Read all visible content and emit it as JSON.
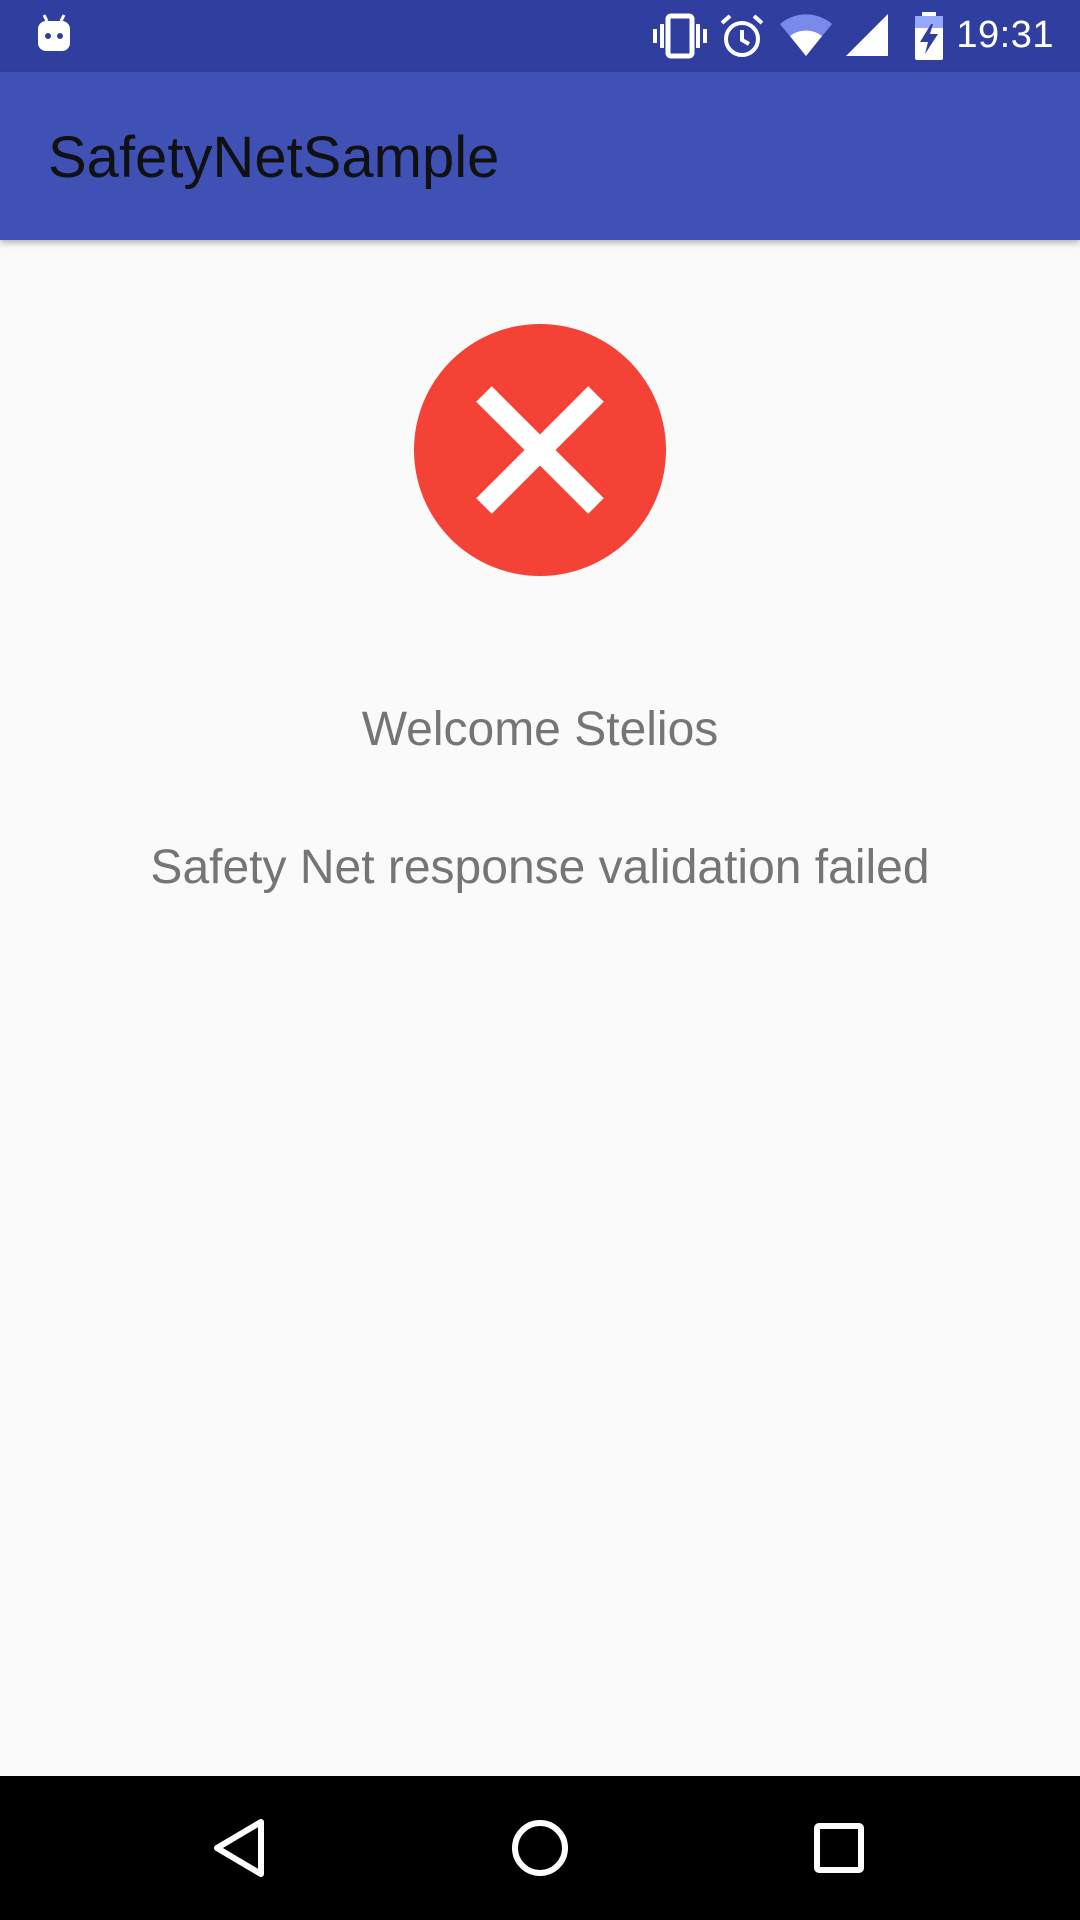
{
  "status_bar": {
    "time": "19:31",
    "notification_icon": "android-debug-icon",
    "icons": [
      "vibrate-icon",
      "alarm-icon",
      "wifi-icon",
      "cell-signal-icon",
      "battery-charging-icon"
    ]
  },
  "app_bar": {
    "title": "SafetyNetSample"
  },
  "main": {
    "status_icon": "error-cross-icon",
    "welcome_text": "Welcome Stelios",
    "result_text": "Safety Net response validation failed"
  },
  "nav_bar": {
    "buttons": [
      "back-icon",
      "home-icon",
      "recents-icon"
    ]
  },
  "colors": {
    "status_bar": "#303f9f",
    "app_bar": "#3f51b5",
    "error_red": "#f44336",
    "body_text": "#757575",
    "background": "#fafafa"
  }
}
